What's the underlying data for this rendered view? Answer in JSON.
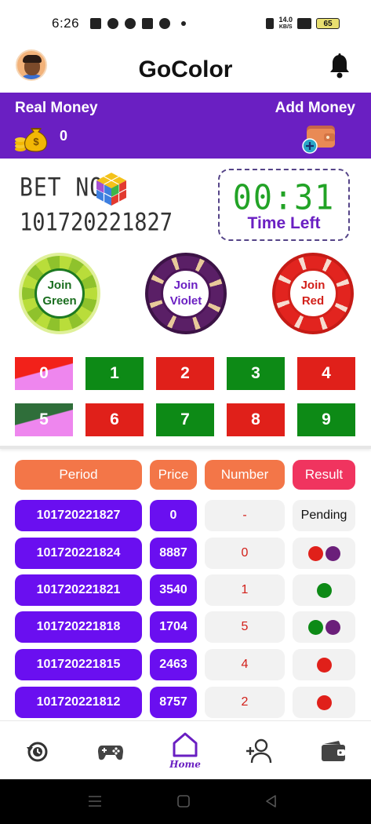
{
  "status_bar": {
    "time": "6:26",
    "net_speed": "14.0",
    "net_unit": "KB/S",
    "battery": "65"
  },
  "header": {
    "title": "GoColor"
  },
  "wallet": {
    "real_money_label": "Real Money",
    "balance": "0",
    "add_money_label": "Add Money"
  },
  "round": {
    "bet_label": "BET NO",
    "bet_number": "101720221827",
    "timer": "00:31",
    "timer_label": "Time Left"
  },
  "chips": [
    {
      "line1": "Join",
      "line2": "Green",
      "color": "green"
    },
    {
      "line1": "Join",
      "line2": "Violet",
      "color": "violet"
    },
    {
      "line1": "Join",
      "line2": "Red",
      "color": "red"
    }
  ],
  "numbers": [
    "0",
    "1",
    "2",
    "3",
    "4",
    "5",
    "6",
    "7",
    "8",
    "9"
  ],
  "colors": {
    "primary": "#6a1fc2",
    "green": "#0d8a16",
    "red": "#e0201a",
    "violet": "#6b1f7a",
    "header_orange": "#f37648",
    "header_pink": "#f0345f"
  },
  "table": {
    "headers": {
      "period": "Period",
      "price": "Price",
      "number": "Number",
      "result": "Result"
    },
    "rows": [
      {
        "period": "101720221827",
        "price": "0",
        "number": "-",
        "result_text": "Pending",
        "dots": []
      },
      {
        "period": "101720221824",
        "price": "8887",
        "number": "0",
        "result_text": "",
        "dots": [
          "red",
          "violet"
        ]
      },
      {
        "period": "101720221821",
        "price": "3540",
        "number": "1",
        "result_text": "",
        "dots": [
          "green"
        ]
      },
      {
        "period": "101720221818",
        "price": "1704",
        "number": "5",
        "result_text": "",
        "dots": [
          "green",
          "violet"
        ]
      },
      {
        "period": "101720221815",
        "price": "2463",
        "number": "4",
        "result_text": "",
        "dots": [
          "red"
        ]
      },
      {
        "period": "101720221812",
        "price": "8757",
        "number": "2",
        "result_text": "",
        "dots": [
          "red"
        ]
      }
    ]
  },
  "bottom_nav": {
    "items": [
      {
        "icon": "history-icon",
        "label": ""
      },
      {
        "icon": "gamepad-icon",
        "label": ""
      },
      {
        "icon": "home-icon",
        "label": "Home"
      },
      {
        "icon": "add-user-icon",
        "label": ""
      },
      {
        "icon": "wallet-icon",
        "label": ""
      }
    ]
  }
}
